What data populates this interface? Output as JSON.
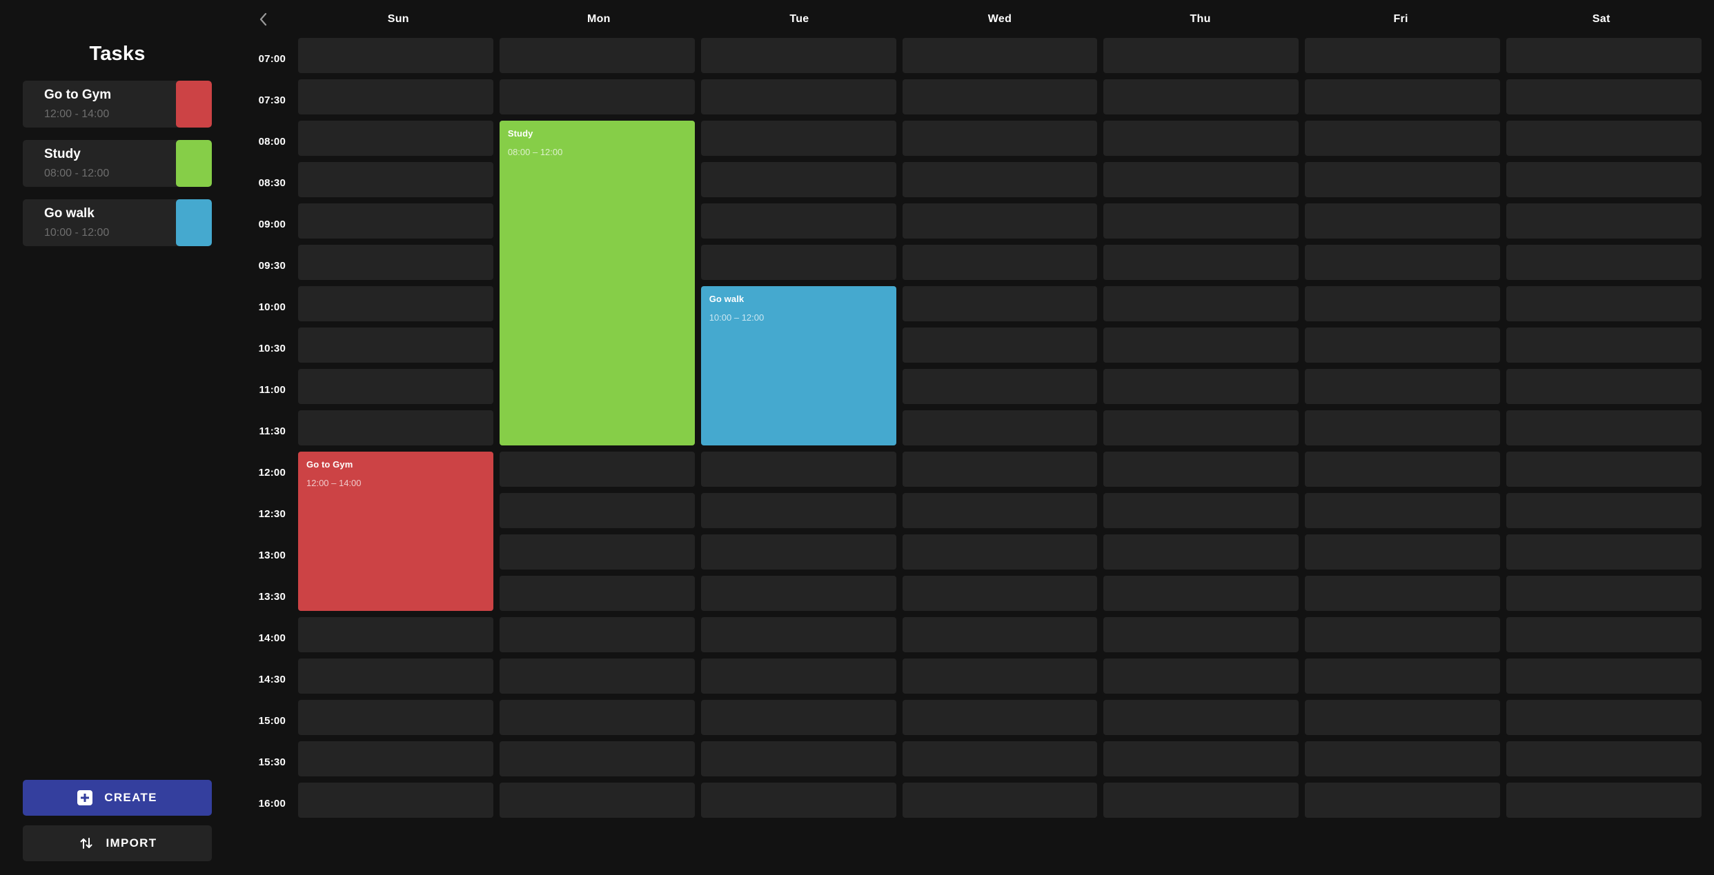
{
  "sidebar": {
    "title": "Tasks",
    "tasks": [
      {
        "name": "Go to Gym",
        "time": "12:00 - 14:00",
        "color": "#cc4345",
        "swatch_icon": "color-swatch-red"
      },
      {
        "name": "Study",
        "time": "08:00 - 12:00",
        "color": "#86ce48",
        "swatch_icon": "color-swatch-green"
      },
      {
        "name": "Go walk",
        "time": "10:00 - 12:00",
        "color": "#45a9cf",
        "swatch_icon": "color-swatch-blue"
      }
    ],
    "actions": {
      "create_label": "CREATE",
      "create_icon": "plus-square-icon",
      "create_color": "#343f9e",
      "import_label": "IMPORT",
      "import_icon": "import-arrows-icon",
      "import_color": "#242424"
    }
  },
  "calendar": {
    "back_icon": "chevron-left-icon",
    "days": [
      "Sun",
      "Mon",
      "Tue",
      "Wed",
      "Thu",
      "Fri",
      "Sat"
    ],
    "times": [
      "07:00",
      "07:30",
      "08:00",
      "08:30",
      "09:00",
      "09:30",
      "10:00",
      "10:30",
      "11:00",
      "11:30",
      "12:00",
      "12:30",
      "13:00",
      "13:30",
      "14:00",
      "14:30",
      "15:00",
      "15:30",
      "16:00"
    ],
    "slot_minutes": 30,
    "start_time": "07:00",
    "events": [
      {
        "title": "Study",
        "time": "08:00 – 12:00",
        "day": "Mon",
        "day_index": 1,
        "start": "08:00",
        "end": "12:00",
        "color": "#86ce48"
      },
      {
        "title": "Go walk",
        "time": "10:00 – 12:00",
        "day": "Tue",
        "day_index": 2,
        "start": "10:00",
        "end": "12:00",
        "color": "#45a9cf"
      },
      {
        "title": "Go to Gym",
        "time": "12:00 – 14:00",
        "day": "Sun",
        "day_index": 0,
        "start": "12:00",
        "end": "14:00",
        "color": "#cc4345"
      }
    ]
  },
  "theme": {
    "background": "#121212",
    "surface": "#242424",
    "text_primary": "#ffffff",
    "text_muted": "#6e6e6e"
  }
}
